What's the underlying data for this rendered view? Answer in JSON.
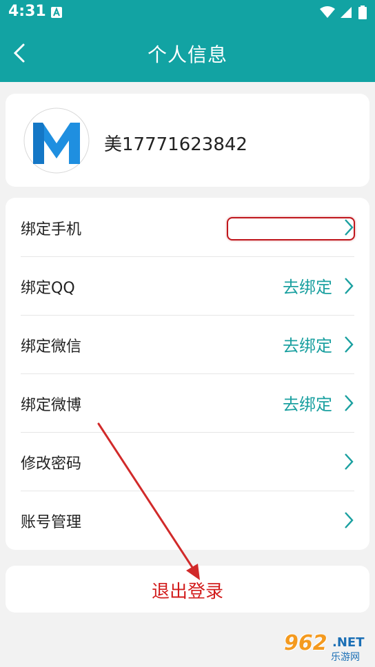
{
  "status_bar": {
    "time": "4:31",
    "notification_icon": "accessibility-a-icon",
    "icons": [
      "wifi-icon",
      "signal-icon",
      "battery-icon"
    ]
  },
  "header": {
    "title": "个人信息",
    "back_icon": "chevron-left-icon"
  },
  "profile": {
    "avatar": "app-logo-m",
    "username": "美17771623842"
  },
  "menu": {
    "items": [
      {
        "label": "绑定手机",
        "value": ""
      },
      {
        "label": "绑定QQ",
        "value": "去绑定"
      },
      {
        "label": "绑定微信",
        "value": "去绑定"
      },
      {
        "label": "绑定微博",
        "value": "去绑定"
      },
      {
        "label": "修改密码",
        "value": ""
      },
      {
        "label": "账号管理",
        "value": ""
      }
    ]
  },
  "logout": {
    "label": "退出登录"
  },
  "watermark": {
    "number": "962",
    "domain": ".NET",
    "sub": "乐游网"
  },
  "colors": {
    "primary": "#12a3a3",
    "accent_text": "#1aa0a0",
    "danger": "#d21c1c",
    "background": "#f2f2f2"
  }
}
